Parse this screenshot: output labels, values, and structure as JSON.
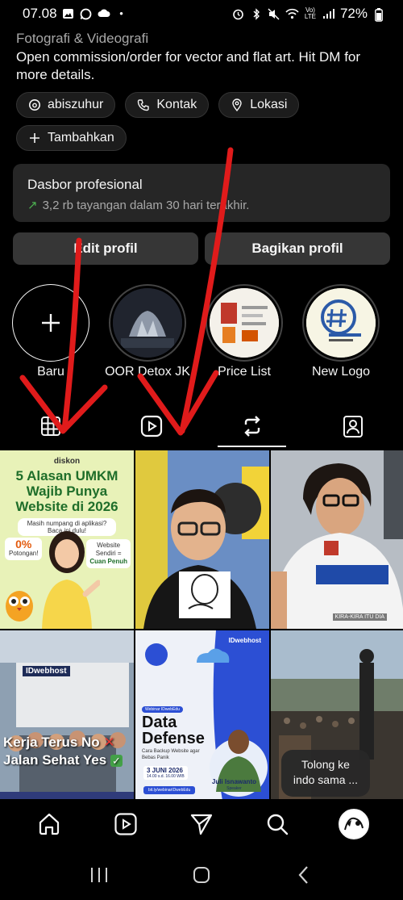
{
  "status_bar": {
    "time": "07.08",
    "battery": "72%",
    "signal_label": "Vo) LTE"
  },
  "bio": {
    "category": "Fotografi & Videografi",
    "text": "Open commission/order for vector and flat art. Hit DM for more details."
  },
  "chips": {
    "threads": "abiszuhur",
    "contact": "Kontak",
    "location": "Lokasi",
    "add": "Tambahkan"
  },
  "dashboard": {
    "title": "Dasbor profesional",
    "stats": "3,2 rb tayangan dalam 30 hari terakhir."
  },
  "buttons": {
    "edit": "Edit profil",
    "share": "Bagikan profil"
  },
  "highlights": [
    {
      "label": "Baru"
    },
    {
      "label": "OOR Detox JK"
    },
    {
      "label": "Price List"
    },
    {
      "label": "New Logo"
    }
  ],
  "posts": {
    "p1": {
      "brand": "diskon",
      "headline": "5 Alasan UMKM Wajib Punya Website di 2026",
      "question": "Masih numpang di aplikasi? Baca ini dulu!",
      "zero": "0%",
      "zero_sub": "Potongan!",
      "website_a": "Website",
      "website_b": "Sendiri =",
      "website_c": "Cuan Penuh"
    },
    "p3": {
      "caption": "KIRA-KIRA ITU DIA"
    },
    "p4": {
      "sign": "IDwebhost",
      "line1": "Kerja Terus No",
      "line2": "Jalan Sehat Yes"
    },
    "p5": {
      "brand": "IDwebhost",
      "pill": "Webinar IDwebEdu",
      "title1": "Data",
      "title2": "Defense",
      "desc": "Cara Backup Website agar Bebas Panik",
      "date": "3 JUNI 2026",
      "time": "14.00 s.d. 16.00 WIB",
      "link": "bit.ly/webinarIDwebEdu",
      "speaker": "Juli Isnawanto",
      "speaker_role": "Speaker"
    }
  },
  "tooltip": "Tolong ke indo sama ...",
  "colors": {
    "accent_green": "#4caf50",
    "annotation_red": "#e01b1b",
    "surface": "#262626",
    "button": "#363636"
  }
}
